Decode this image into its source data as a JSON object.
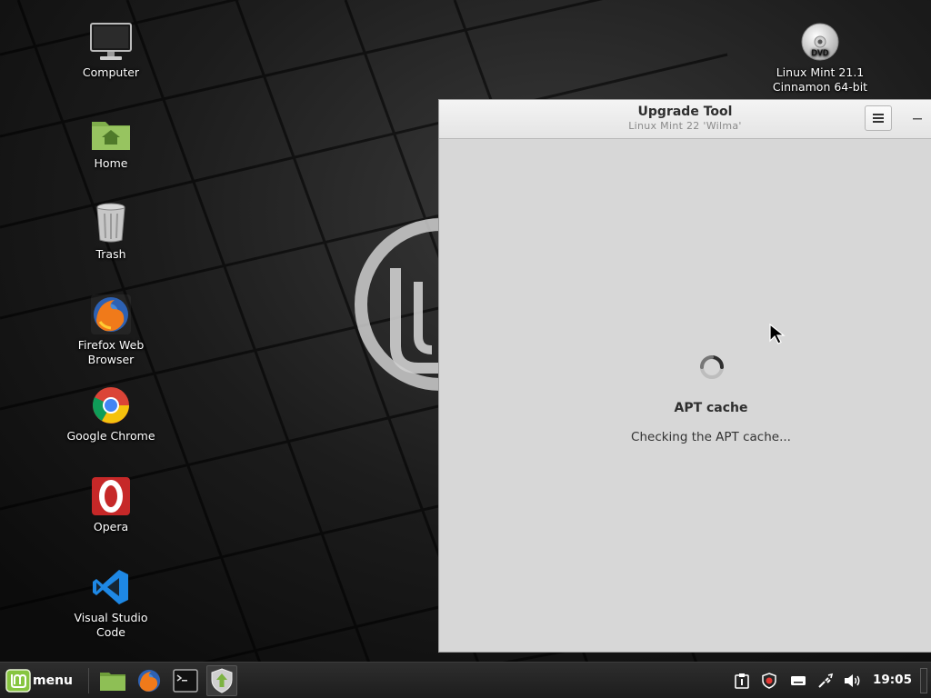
{
  "desktop": {
    "icons": [
      {
        "label": "Computer",
        "icon": "monitor-icon"
      },
      {
        "label": "Home",
        "icon": "home-folder-icon"
      },
      {
        "label": "Trash",
        "icon": "trash-icon"
      },
      {
        "label": "Firefox Web Browser",
        "icon": "firefox-icon"
      },
      {
        "label": "Google Chrome",
        "icon": "chrome-icon"
      },
      {
        "label": "Opera",
        "icon": "opera-icon"
      },
      {
        "label": "Visual Studio Code",
        "icon": "vscode-icon"
      }
    ],
    "dvd": {
      "line1": "Linux Mint 21.1",
      "line2": "Cinnamon 64-bit",
      "disc_text": "DVD",
      "icon": "dvd-disc-icon"
    }
  },
  "window": {
    "title": "Upgrade Tool",
    "subtitle": "Linux Mint 22 'Wilma'",
    "menu_icon": "hamburger-menu-icon",
    "minimize_icon": "minimize-icon",
    "status_heading": "APT cache",
    "status_text": "Checking the APT cache...",
    "spinner_icon": "loading-spinner-icon"
  },
  "panel": {
    "menu_label": "menu",
    "launchers": [
      "files-icon",
      "firefox-icon",
      "terminal-icon",
      "upgrade-tool-icon"
    ],
    "tray": [
      "clipboard-icon",
      "shield-icon",
      "keyboard-icon",
      "network-icon",
      "volume-icon"
    ],
    "clock": "19:05"
  },
  "colors": {
    "mint_green": "#8bc34a",
    "window_bg": "#d7d7d7",
    "panel_bg": "#222222"
  }
}
